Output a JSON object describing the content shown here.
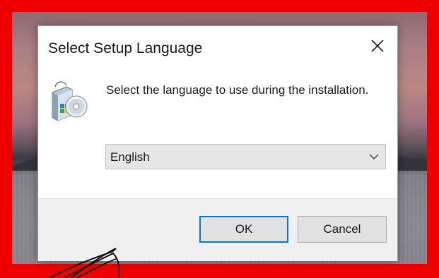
{
  "dialog": {
    "title": "Select Setup Language",
    "prompt": "Select the language to use during the installation.",
    "language_select": {
      "value": "English"
    },
    "buttons": {
      "ok_label": "OK",
      "cancel_label": "Cancel"
    }
  },
  "icons": {
    "close": "close-icon",
    "setup": "setup-cd-icon",
    "dropdown": "chevron-down-icon"
  },
  "colors": {
    "frame": "#ee0000",
    "default_button_border": "#0078d7",
    "footer_background": "#f0f0f0",
    "select_background": "#e6e6e6"
  }
}
